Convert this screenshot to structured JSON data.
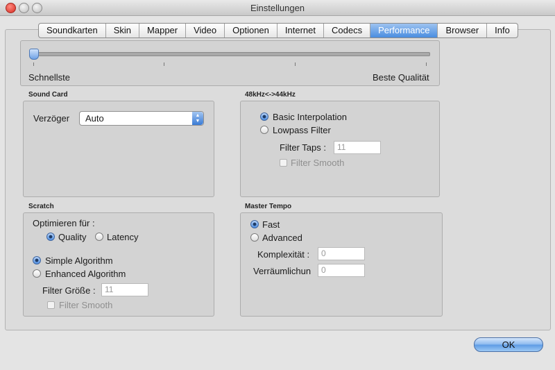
{
  "window": {
    "title": "Einstellungen"
  },
  "tabs": [
    "Soundkarten",
    "Skin",
    "Mapper",
    "Video",
    "Optionen",
    "Internet",
    "Codecs",
    "Performance",
    "Browser",
    "Info"
  ],
  "active_tab": "Performance",
  "quality_slider": {
    "left_label": "Schnellste",
    "right_label": "Beste Qualität",
    "value": 0
  },
  "sound_card": {
    "title": "Sound Card",
    "delay_label": "Verzöger",
    "delay_value": "Auto"
  },
  "resample": {
    "title": "48kHz<->44kHz",
    "basic": "Basic Interpolation",
    "lowpass": "Lowpass Filter",
    "filter_taps_label": "Filter Taps :",
    "filter_taps_value": "11",
    "filter_smooth": "Filter Smooth"
  },
  "scratch": {
    "title": "Scratch",
    "optimize_label": "Optimieren für :",
    "quality": "Quality",
    "latency": "Latency",
    "simple": "Simple Algorithm",
    "enhanced": "Enhanced Algorithm",
    "filter_size_label": "Filter Größe :",
    "filter_size_value": "11",
    "filter_smooth": "Filter Smooth"
  },
  "master_tempo": {
    "title": "Master Tempo",
    "fast": "Fast",
    "advanced": "Advanced",
    "complexity_label": "Komplexität :",
    "complexity_value": "0",
    "spatial_label": "Verräumlichun",
    "spatial_value": "0"
  },
  "buttons": {
    "ok": "OK"
  },
  "colors": {
    "accent": "#4a8de0",
    "panel": "#d3d3d3"
  }
}
